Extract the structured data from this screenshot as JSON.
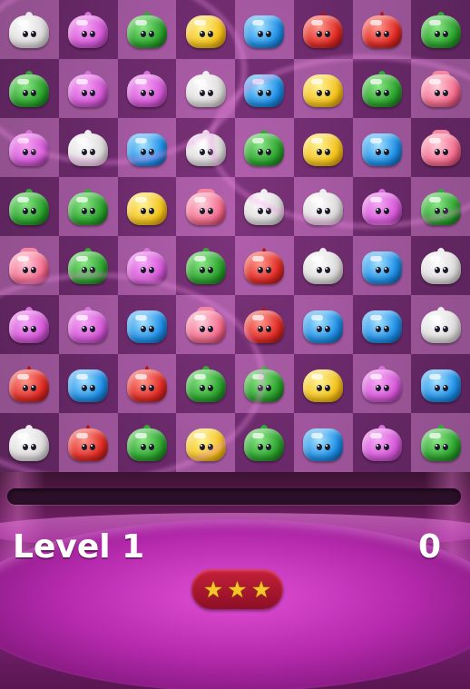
{
  "game": {
    "board": {
      "rows": [
        [
          "white",
          "purple",
          "green",
          "yellow",
          "blue",
          "red",
          "red",
          "green"
        ],
        [
          "green",
          "purple",
          "purple",
          "white",
          "blue",
          "yellow",
          "green",
          "pink"
        ],
        [
          "purple",
          "white",
          "blue",
          "white",
          "green",
          "yellow",
          "blue",
          "pink"
        ],
        [
          "green",
          "green",
          "yellow",
          "pink",
          "white",
          "white",
          "purple",
          "green"
        ],
        [
          "pink",
          "green",
          "purple",
          "green",
          "red",
          "white",
          "blue",
          "white"
        ],
        [
          "purple",
          "purple",
          "blue",
          "pink",
          "red",
          "blue",
          "blue",
          "white"
        ],
        [
          "red",
          "blue",
          "red",
          "green",
          "green",
          "yellow",
          "purple",
          "blue"
        ],
        [
          "white",
          "red",
          "green",
          "yellow",
          "green",
          "blue",
          "purple",
          "green"
        ]
      ]
    },
    "hud": {
      "level_label": "Level 1",
      "score": "0",
      "stars_earned": 3,
      "stars_total": 3,
      "progress_fraction": 0.0
    }
  },
  "colors": {
    "progress_fill": "#5dd35a",
    "star": "#f6c52a"
  }
}
